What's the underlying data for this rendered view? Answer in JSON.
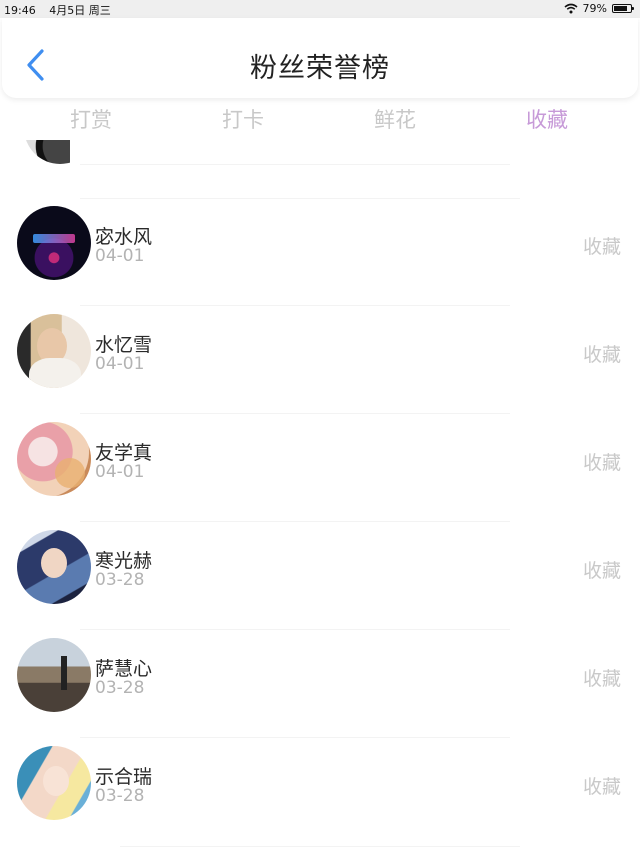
{
  "status_bar": {
    "time": "19:46",
    "date": "4月5日 周三",
    "battery": "79%",
    "battery_level": 0.79
  },
  "header": {
    "title": "粉丝荣誉榜"
  },
  "tabs": [
    {
      "label": "打赏",
      "active": false
    },
    {
      "label": "打卡",
      "active": false
    },
    {
      "label": "鲜花",
      "active": false
    },
    {
      "label": "收藏",
      "active": true
    }
  ],
  "rows": [
    {
      "name": "宓水风",
      "date": "04-01",
      "action": "收藏"
    },
    {
      "name": "水忆雪",
      "date": "04-01",
      "action": "收藏"
    },
    {
      "name": "友学真",
      "date": "04-01",
      "action": "收藏"
    },
    {
      "name": "寒光赫",
      "date": "03-28",
      "action": "收藏"
    },
    {
      "name": "萨慧心",
      "date": "03-28",
      "action": "收藏"
    },
    {
      "name": "示合瑞",
      "date": "03-28",
      "action": "收藏"
    }
  ],
  "colors": {
    "accent": "#c79ad8",
    "inactive_tab": "#c8c8c8",
    "back_arrow": "#3f8ef0"
  }
}
